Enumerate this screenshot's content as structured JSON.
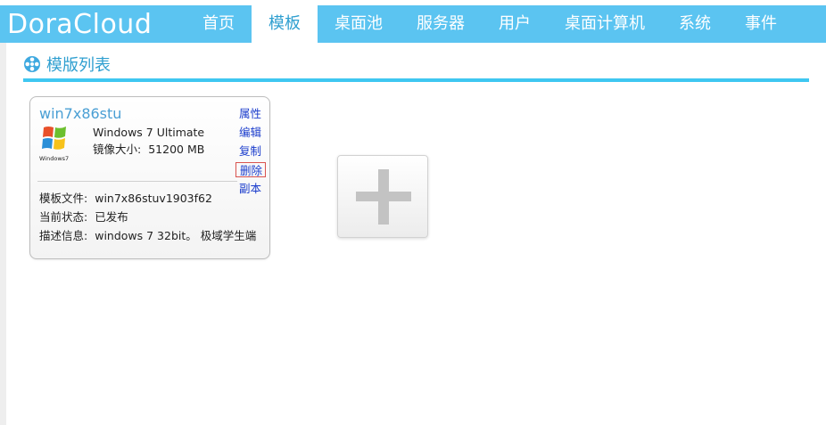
{
  "app": {
    "logo": "DoraCloud"
  },
  "nav": {
    "items": [
      {
        "label": "首页",
        "active": false
      },
      {
        "label": "模板",
        "active": true
      },
      {
        "label": "桌面池",
        "active": false
      },
      {
        "label": "服务器",
        "active": false
      },
      {
        "label": "用户",
        "active": false
      },
      {
        "label": "桌面计算机",
        "active": false
      },
      {
        "label": "系统",
        "active": false
      },
      {
        "label": "事件",
        "active": false
      }
    ]
  },
  "section": {
    "title": "模版列表",
    "icon": "film-reel-icon"
  },
  "template_card": {
    "name": "win7x86stu",
    "logo_text": "Windows7",
    "os": "Windows 7 Ultimate",
    "image_size_label": "镜像大小:",
    "image_size_value": "51200 MB",
    "file_label": "模板文件:",
    "file_value": "win7x86stuv1903f62",
    "status_label": "当前状态:",
    "status_value": "已发布",
    "desc_label": "描述信息:",
    "desc_value": "windows 7 32bit。 极域学生端",
    "actions": [
      "属性",
      "编辑",
      "复制",
      "删除",
      "副本"
    ],
    "highlighted_action": "删除"
  },
  "add_card": {
    "icon": "plus-icon"
  },
  "colors": {
    "navbar": "#5bc4f1",
    "accent": "#2f9fd0",
    "rule": "#3fc7f1",
    "action_link": "#1a3ccc",
    "highlight_border": "#d9534f"
  }
}
